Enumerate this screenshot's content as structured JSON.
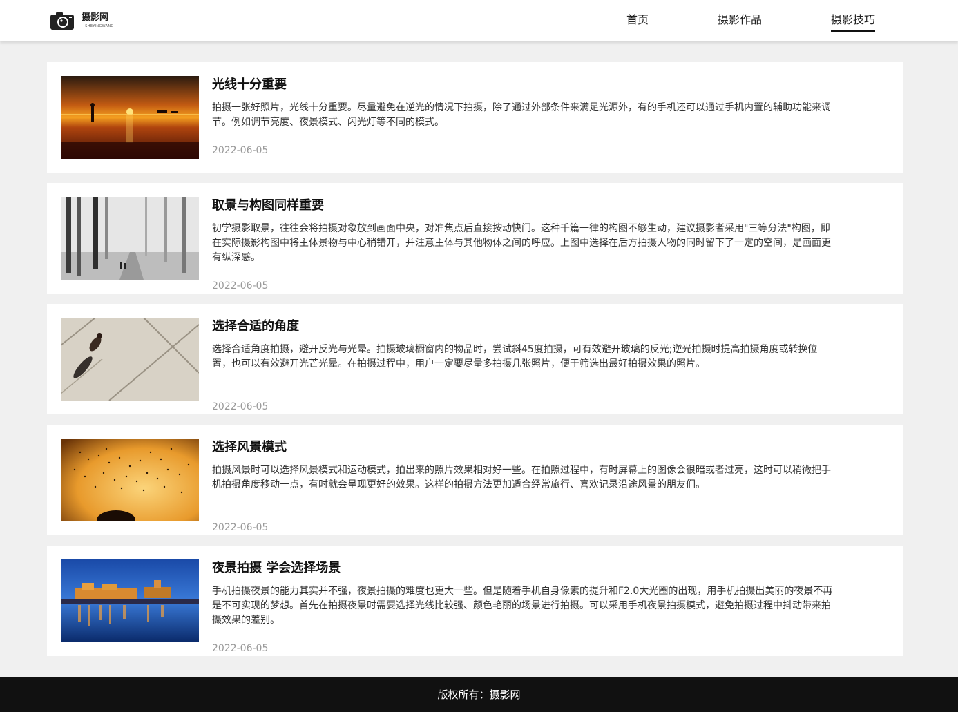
{
  "header": {
    "logo_name": "摄影网",
    "logo_sub": "—SHEYINGWANG—",
    "nav": [
      {
        "label": "首页"
      },
      {
        "label": "摄影作品"
      },
      {
        "label": "摄影技巧",
        "active": true
      }
    ]
  },
  "articles": [
    {
      "title": "光线十分重要",
      "desc": "拍摄一张好照片，光线十分重要。尽量避免在逆光的情况下拍摄，除了通过外部条件来满足光源外，有的手机还可以通过手机内置的辅助功能来调节。例如调节亮度、夜景模式、闪光灯等不同的模式。",
      "date": "2022-06-05",
      "image": "sunset-beach-photo"
    },
    {
      "title": "取景与构图同样重要",
      "desc": "初学摄影取景，往往会将拍摄对象放到画面中央，对准焦点后直接按动快门。这种千篇一律的构图不够生动，建议摄影者采用\"三等分法\"构图，即在实际摄影构图中将主体景物与中心稍错开，并注意主体与其他物体之间的呼应。上图中选择在后方拍摄人物的同时留下了一定的空间，是画面更有纵深感。",
      "date": "2022-06-05",
      "image": "foggy-trees-photo"
    },
    {
      "title": "选择合适的角度",
      "desc": "选择合适角度拍摄，避开反光与光晕。拍摄玻璃橱窗内的物品时，尝试斜45度拍摄，可有效避开玻璃的反光;逆光拍摄时提高拍摄角度或转换位置，也可以有效避开光芒光晕。在拍摄过程中，用户一定要尽量多拍摄几张照片，便于筛选出最好拍摄效果的照片。",
      "date": "2022-06-05",
      "image": "overhead-walker-photo"
    },
    {
      "title": "选择风景模式",
      "desc": "拍摄风景时可以选择风景模式和运动模式，拍出来的照片效果相对好一些。在拍照过程中，有时屏幕上的图像会很暗或者过亮，这时可以稍微把手机拍摄角度移动一点，有时就会呈现更好的效果。这样的拍摄方法更加适合经常旅行、喜欢记录沿途风景的朋友们。",
      "date": "2022-06-05",
      "image": "birds-sky-photo"
    },
    {
      "title": "夜景拍摄 学会选择场景",
      "desc": "手机拍摄夜景的能力其实并不强，夜景拍摄的难度也更大一些。但是随着手机自身像素的提升和F2.0大光圈的出现，用手机拍摄出美丽的夜景不再是不可实现的梦想。首先在拍摄夜景时需要选择光线比较强、颜色艳丽的场景进行拍摄。可以采用手机夜景拍摄模式，避免拍摄过程中抖动带来拍摄效果的差别。",
      "date": "2022-06-05",
      "image": "night-city-photo"
    }
  ],
  "footer": {
    "text": "版权所有：摄影网"
  }
}
